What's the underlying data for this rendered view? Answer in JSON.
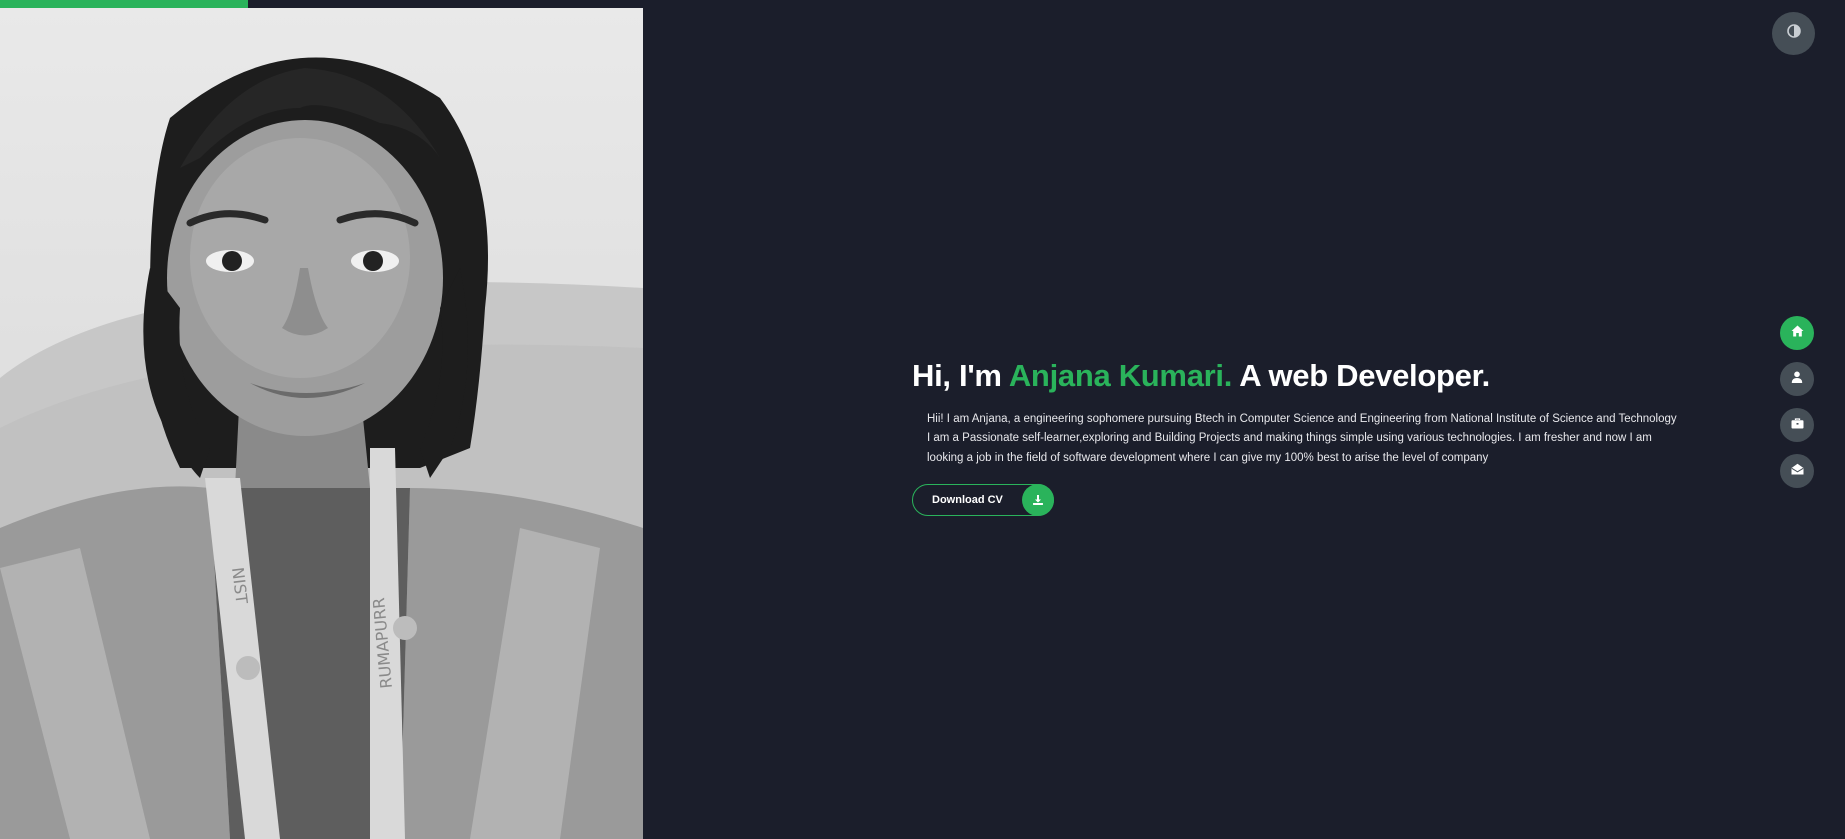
{
  "colors": {
    "background": "#1b1e2b",
    "accent": "#2ab35b",
    "control": "#454e56",
    "text": "#ffffff"
  },
  "hero": {
    "greeting": "Hi, I'm ",
    "name": "Anjana Kumari.",
    "role": " A web Developer.",
    "about": "Hii! I am Anjana, a engineering sophomere pursuing Btech in Computer Science and Engineering from National Institute of Science and Technology I am a Passionate self-learner,exploring and Building Projects and making things simple using various technologies. I am fresher and now I am looking a job in the field of software development where I can give my 100% best to arise the level of company",
    "cv_label": "Download CV",
    "cv_icon": "download-icon"
  },
  "photo": {
    "alt": "Anjana Kumari portrait",
    "lanyard_text": "NIST",
    "lanyard_text_lower": "RUMAPURR"
  },
  "theme_toggle": {
    "icon": "contrast-icon"
  },
  "nav": {
    "items": [
      {
        "name": "home",
        "icon": "home-icon",
        "active": true
      },
      {
        "name": "about",
        "icon": "user-icon",
        "active": false
      },
      {
        "name": "portfolio",
        "icon": "briefcase-icon",
        "active": false
      },
      {
        "name": "contact",
        "icon": "envelope-open-icon",
        "active": false
      }
    ]
  }
}
